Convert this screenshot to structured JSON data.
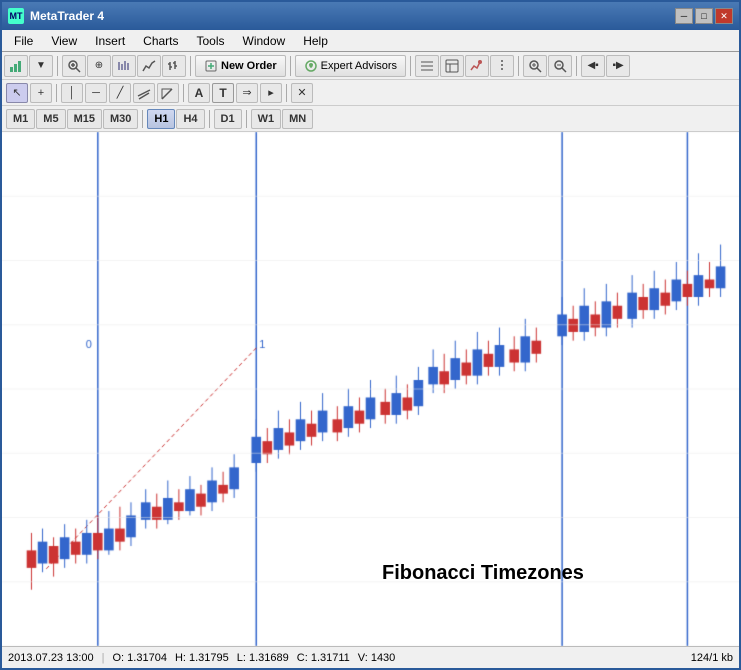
{
  "window": {
    "title": "MetaTrader 4",
    "icon": "MT4"
  },
  "title_bar": {
    "text": "MetaTrader 4",
    "minimize_label": "─",
    "restore_label": "□",
    "close_label": "✕"
  },
  "menu": {
    "items": [
      "File",
      "View",
      "Insert",
      "Charts",
      "Tools",
      "Window",
      "Help"
    ]
  },
  "toolbar": {
    "new_order_label": "New Order",
    "expert_advisors_label": "Expert Advisors"
  },
  "timeframes": {
    "items": [
      "M1",
      "M5",
      "M15",
      "M30",
      "H1",
      "H4",
      "D1",
      "W1",
      "MN"
    ],
    "active": "H1"
  },
  "status_bar": {
    "datetime": "2013.07.23 13:00",
    "open": "O: 1.31704",
    "high": "H: 1.31795",
    "low": "L: 1.31689",
    "close": "C: 1.31711",
    "volume": "V: 1430",
    "info": "124/1 kb"
  },
  "chart": {
    "label": "Fibonacci Timezones",
    "fib_label_0": "0",
    "fib_label_1": "1"
  }
}
